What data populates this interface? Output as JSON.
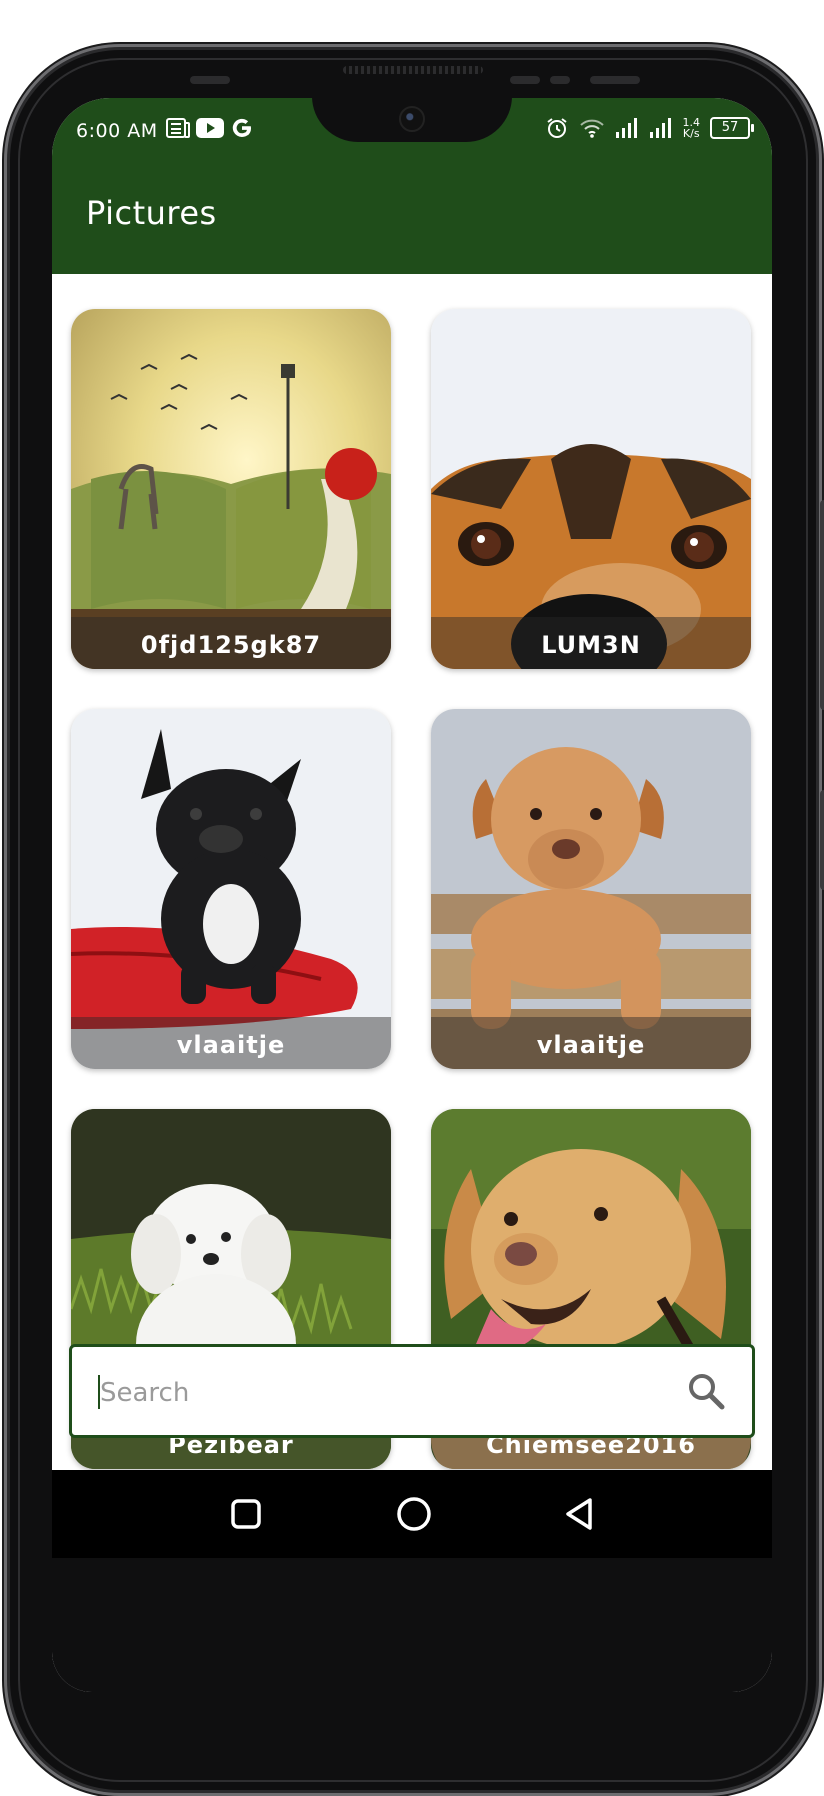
{
  "status_bar": {
    "time": "6:00 AM",
    "speed_top": "1.4",
    "speed_bottom": "K/s",
    "battery": "57",
    "icons": [
      "news-icon",
      "youtube-icon",
      "google-icon",
      "alarm-icon",
      "wifi-icon",
      "signal-icon",
      "signal-icon-2"
    ]
  },
  "app_bar": {
    "title": "Pictures"
  },
  "pictures": [
    {
      "author": "0fjd125gk87",
      "subject": "book-landscape-with-dog"
    },
    {
      "author": "LUM3N",
      "subject": "dog-face-closeup"
    },
    {
      "author": "vlaaitje",
      "subject": "french-bulldog-on-red-pillow"
    },
    {
      "author": "vlaaitje",
      "subject": "puppy-on-fence"
    },
    {
      "author": "Pezibear",
      "subject": "white-puppy-in-grass"
    },
    {
      "author": "Chiemsee2016",
      "subject": "golden-labrador"
    }
  ],
  "search": {
    "placeholder": "Search",
    "value": ""
  },
  "navigation": [
    "back-button",
    "home-button",
    "recent-apps-button"
  ],
  "colors": {
    "primary": "#1f4d1a",
    "caption_overlay": "rgba(40,40,40,0.45)"
  }
}
